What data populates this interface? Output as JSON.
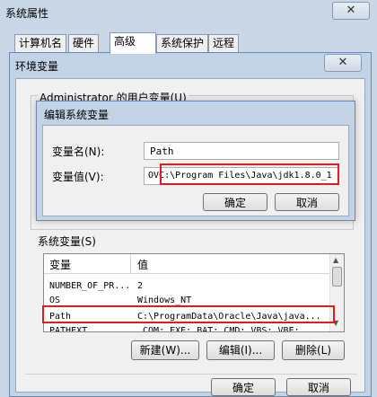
{
  "system_properties": {
    "title": "系统属性",
    "tabs": [
      "计算机名",
      "硬件",
      "高级",
      "系统保护",
      "远程"
    ],
    "ok_label": "确定",
    "cancel_label": "取消"
  },
  "env_vars": {
    "title": "环境变量",
    "user_section_label": "Administrator 的用户变量(U)",
    "system_section_label": "系统变量(S)",
    "columns": [
      "变量",
      "值"
    ],
    "rows": [
      {
        "name": "NUMBER_OF_PR...",
        "value": "2"
      },
      {
        "name": "OS",
        "value": "Windows_NT"
      },
      {
        "name": "Path",
        "value": "C:\\ProgramData\\Oracle\\Java\\java..."
      },
      {
        "name": "PATHEXT",
        "value": ".COM;.EXE;.BAT;.CMD;.VBS;.VBE;"
      }
    ],
    "new_label": "新建(W)...",
    "edit_label": "编辑(I)...",
    "delete_label": "删除(L)",
    "ok_label": "确定",
    "cancel_label": "取消"
  },
  "edit_dialog": {
    "title": "编辑系统变量",
    "name_label": "变量名(N):",
    "value_label": "变量值(V):",
    "name_value": "Path",
    "value_prefix": "OV",
    "value_value": "C:\\Program Files\\Java\\jdk1.8.0_1",
    "ok_label": "确定",
    "cancel_label": "取消"
  },
  "icons": {
    "close": "close-icon",
    "scroll_up": "scroll-up-icon",
    "scroll_down": "scroll-down-icon"
  },
  "colors": {
    "highlight_box": "#e21b1b",
    "window_frame": "#c9d6e5"
  }
}
